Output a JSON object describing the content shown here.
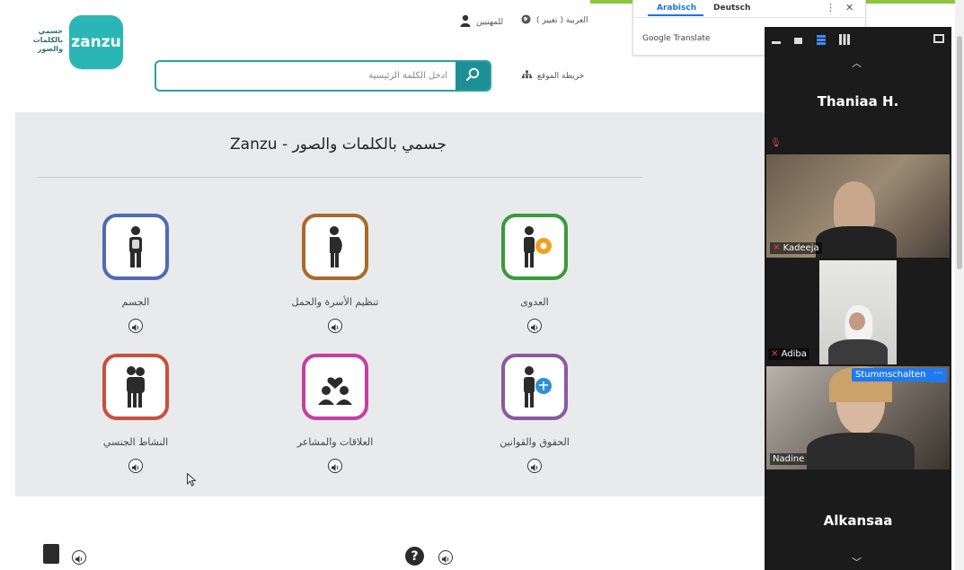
{
  "header": {
    "logo_text": "جسمي بالكلمات والصور",
    "logo_brand": "zanzu",
    "language_link": "( تغيير ) العربية",
    "professionals_link": "للمهنيين",
    "sitemap_link": "خريطة الموقع",
    "search_placeholder": "أدخل الكلمة الرئيسية"
  },
  "translate": {
    "tab_active": "Arabisch",
    "tab_other": "Deutsch",
    "brand": "Google Translate"
  },
  "main": {
    "title": "جسمي بالكلمات والصور - Zanzu",
    "categories": [
      {
        "label": "العدوى",
        "color": "#3a9a3c"
      },
      {
        "label": "تنظيم الأسرة والحمل",
        "color": "#a86a2a"
      },
      {
        "label": "الجسم",
        "color": "#4f6bb5"
      },
      {
        "label": "الحقوق والقوانين",
        "color": "#8a5a9e"
      },
      {
        "label": "العلاقات والمشاعر",
        "color": "#c63ea0"
      },
      {
        "label": "النشاط الجنسي",
        "color": "#c8503c"
      }
    ]
  },
  "zoom": {
    "participants": [
      {
        "name": "Thaniaa H."
      },
      {
        "name": "Kadeeja"
      },
      {
        "name": "Adiba"
      },
      {
        "name": "Nadine"
      },
      {
        "name": "Alkansaa"
      }
    ],
    "mute_button": "Stummschalten",
    "more_button": "···"
  }
}
